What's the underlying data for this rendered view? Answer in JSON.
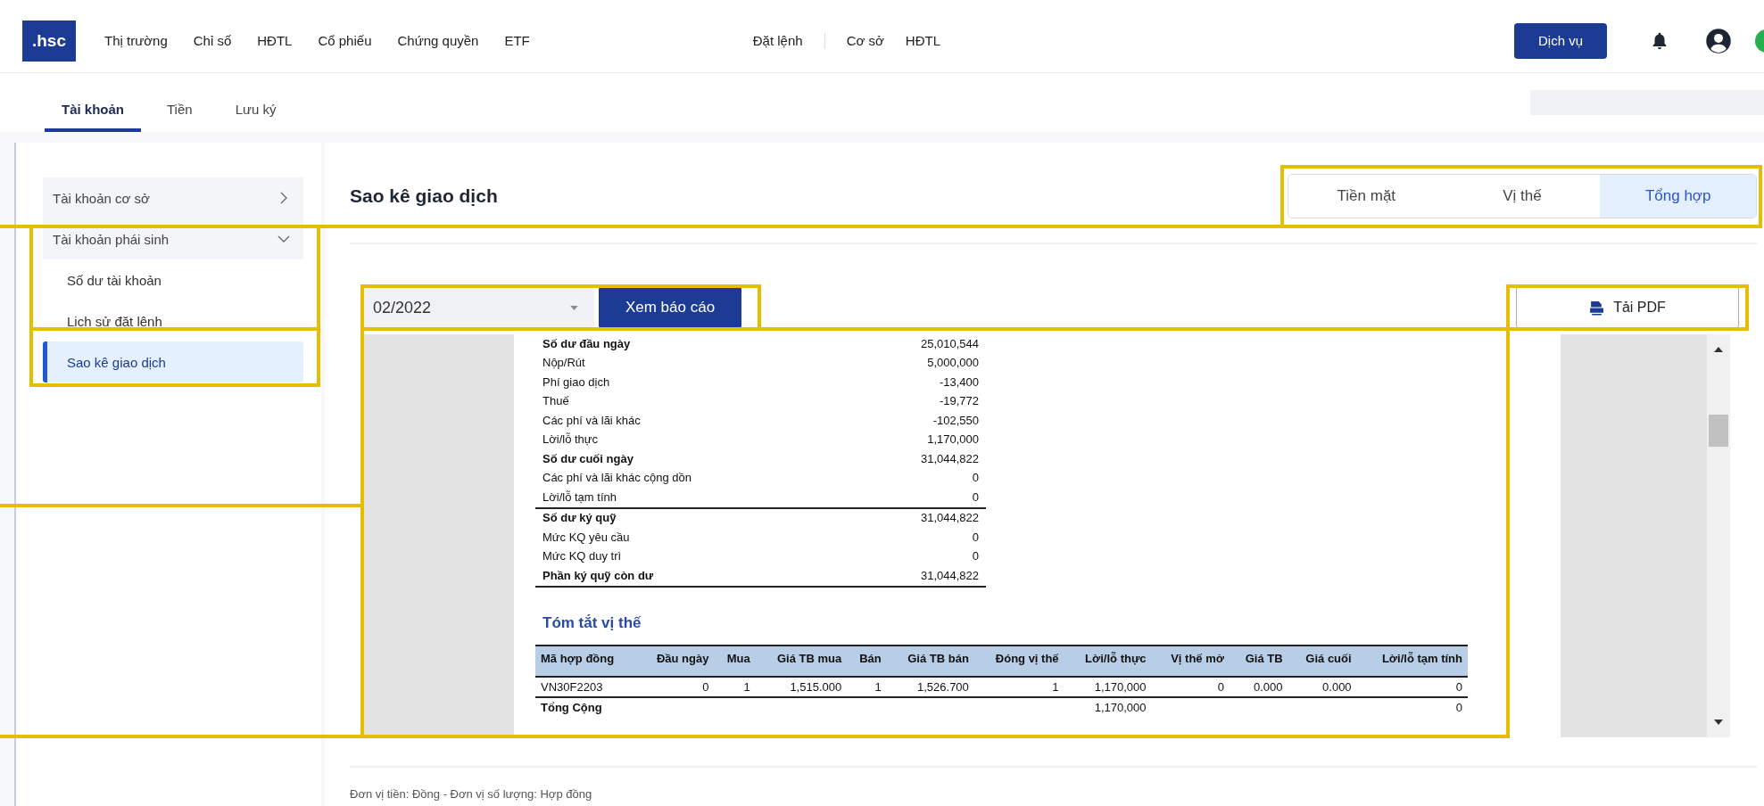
{
  "top_nav": {
    "logo": ".hsc",
    "market_menu": [
      {
        "label": "Thị trường"
      },
      {
        "label": "Chỉ số"
      },
      {
        "label": "HĐTL"
      },
      {
        "label": "Cổ phiếu"
      },
      {
        "label": "Chứng quyền"
      },
      {
        "label": "ETF"
      }
    ],
    "order_menu": [
      {
        "label": "Đặt lệnh"
      },
      {
        "label": "Cơ sở"
      },
      {
        "label": "HĐTL"
      }
    ],
    "service_button": "Dịch vụ"
  },
  "sub_tabs": [
    {
      "label": "Tài khoản",
      "selected": true
    },
    {
      "label": "Tiền",
      "selected": false
    },
    {
      "label": "Lưu ký",
      "selected": false
    }
  ],
  "sidebar": {
    "items": [
      {
        "kind": "group",
        "label": "Tài khoản cơ sở",
        "expanded": false
      },
      {
        "kind": "group",
        "label": "Tài khoản phái sinh",
        "expanded": true
      },
      {
        "kind": "item",
        "label": "Số dư tài khoản",
        "selected": false
      },
      {
        "kind": "item",
        "label": "Lịch sử đặt lệnh",
        "selected": false
      },
      {
        "kind": "item",
        "label": "Sao kê giao dịch",
        "selected": true
      }
    ]
  },
  "page_title": "Sao kê giao dịch",
  "view_tabs": [
    {
      "label": "Tiền mặt",
      "selected": false
    },
    {
      "label": "Vị thế",
      "selected": false
    },
    {
      "label": "Tổng hợp",
      "selected": true
    }
  ],
  "period_select": {
    "value": "02/2022"
  },
  "view_report_button": "Xem báo cáo",
  "download_pdf_button": "Tải PDF",
  "statement": {
    "summary_rows": [
      {
        "label": "Số dư đầu ngày",
        "value": "25,010,544",
        "bold": true,
        "rule_below": false
      },
      {
        "label": "Nộp/Rút",
        "value": "5,000,000",
        "bold": false,
        "rule_below": false
      },
      {
        "label": "Phí giao dịch",
        "value": "-13,400",
        "bold": false,
        "rule_below": false
      },
      {
        "label": "Thuế",
        "value": "-19,772",
        "bold": false,
        "rule_below": false
      },
      {
        "label": "Các phí và lãi khác",
        "value": "-102,550",
        "bold": false,
        "rule_below": false
      },
      {
        "label": "Lời/lỗ thực",
        "value": "1,170,000",
        "bold": false,
        "rule_below": false
      },
      {
        "label": "Số dư cuối ngày",
        "value": "31,044,822",
        "bold": true,
        "rule_below": false
      },
      {
        "label": "Các phí và lãi khác cộng dồn",
        "value": "0",
        "bold": false,
        "rule_below": false
      },
      {
        "label": "Lời/lỗ tạm tính",
        "value": "0",
        "bold": false,
        "rule_below": true
      },
      {
        "label": "Số dư ký quỹ",
        "value": "31,044,822",
        "bold": true,
        "rule_below": false
      },
      {
        "label": "Mức KQ yêu cầu",
        "value": "0",
        "bold": false,
        "rule_below": false
      },
      {
        "label": "Mức KQ duy trì",
        "value": "0",
        "bold": false,
        "rule_below": false
      },
      {
        "label": "Phần ký quỹ còn dư",
        "value": "31,044,822",
        "bold": true,
        "rule_below": true
      }
    ],
    "positions_title": "Tóm tắt vị thế",
    "positions_table": {
      "columns": [
        "Mã hợp đồng",
        "Đầu ngày",
        "Mua",
        "Giá TB mua",
        "Bán",
        "Giá TB bán",
        "Đóng vị thế",
        "Lời/lỗ thực",
        "Vị thế mở",
        "Giá TB",
        "Giá cuối",
        "Lời/lỗ tạm tính"
      ],
      "rows": [
        [
          "VN30F2203",
          "0",
          "1",
          "1,515.000",
          "1",
          "1,526.700",
          "1",
          "1,170,000",
          "0",
          "0.000",
          "0.000",
          "0"
        ]
      ],
      "total_row": {
        "label": "Tổng Cộng",
        "realized_pnl": "1,170,000",
        "unrealized_pnl": "0"
      }
    }
  },
  "footer_note": "Đơn vị tiền: Đồng - Đơn vị số lượng: Hợp đồng"
}
